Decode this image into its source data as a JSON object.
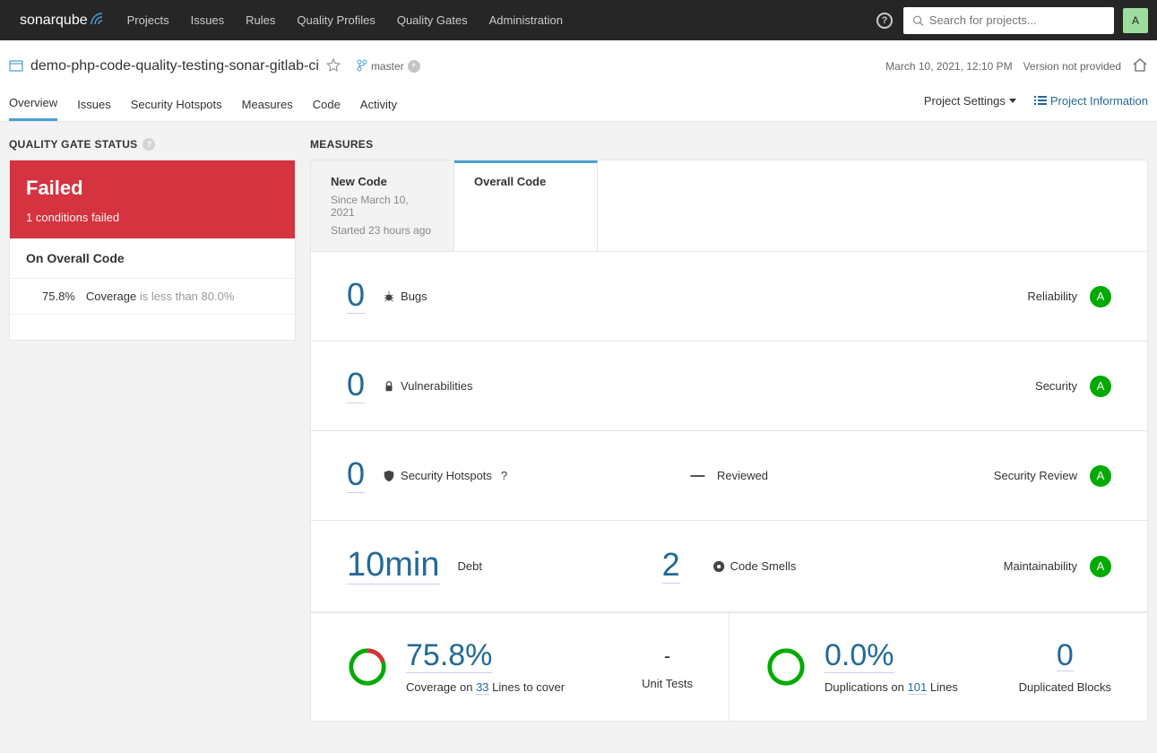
{
  "nav": {
    "logo_prefix": "sonar",
    "logo_suffix": "qube",
    "items": [
      "Projects",
      "Issues",
      "Rules",
      "Quality Profiles",
      "Quality Gates",
      "Administration"
    ],
    "search_placeholder": "Search for projects...",
    "user_initial": "A"
  },
  "project": {
    "name": "demo-php-code-quality-testing-sonar-gitlab-ci",
    "branch": "master",
    "analyzed_at": "March 10, 2021, 12:10 PM",
    "version_label": "Version not provided",
    "tabs": [
      "Overview",
      "Issues",
      "Security Hotspots",
      "Measures",
      "Code",
      "Activity"
    ],
    "active_tab": "Overview",
    "settings_label": "Project Settings",
    "info_label": "Project Information"
  },
  "quality_gate": {
    "title": "QUALITY GATE STATUS",
    "status": "Failed",
    "summary": "1 conditions failed",
    "section": "On Overall Code",
    "condition": {
      "value": "75.8%",
      "metric": "Coverage",
      "note": "is less than 80.0%"
    }
  },
  "measures": {
    "title": "MEASURES",
    "tabs": {
      "new": {
        "label": "New Code",
        "since": "Since March 10, 2021",
        "started": "Started 23 hours ago"
      },
      "overall": {
        "label": "Overall Code"
      }
    },
    "rows": {
      "bugs": {
        "value": "0",
        "label": "Bugs",
        "rating_label": "Reliability",
        "rating": "A"
      },
      "vuln": {
        "value": "0",
        "label": "Vulnerabilities",
        "rating_label": "Security",
        "rating": "A"
      },
      "hotspots": {
        "value": "0",
        "label": "Security Hotspots",
        "reviewed_dash": "—",
        "reviewed_label": "Reviewed",
        "rating_label": "Security Review",
        "rating": "A"
      },
      "maint": {
        "debt": "10min",
        "debt_label": "Debt",
        "smells": "2",
        "smells_label": "Code Smells",
        "rating_label": "Maintainability",
        "rating": "A"
      }
    },
    "footer": {
      "coverage": {
        "value": "75.8%",
        "prefix": "Coverage on ",
        "lines": "33",
        "suffix": " Lines to cover"
      },
      "unit": {
        "dash": "-",
        "label": "Unit Tests"
      },
      "dup": {
        "value": "0.0%",
        "prefix": "Duplications on ",
        "lines": "101",
        "suffix": " Lines"
      },
      "blocks": {
        "value": "0",
        "label": "Duplicated Blocks"
      }
    }
  }
}
